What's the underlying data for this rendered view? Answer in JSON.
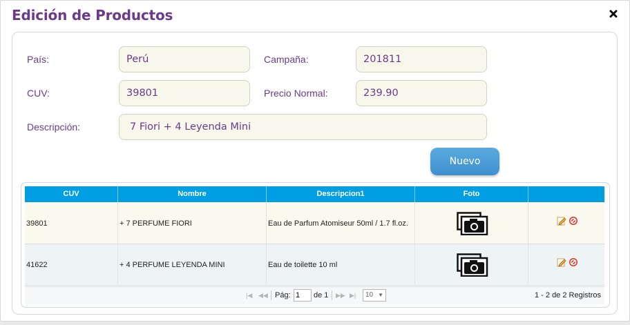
{
  "dialog": {
    "title": "Edición de Productos",
    "close_icon": "close-icon"
  },
  "form": {
    "pais_label": "País:",
    "pais_value": "Perú",
    "campana_label": "Campaña:",
    "campana_value": "201811",
    "cuv_label": "CUV:",
    "cuv_value": "39801",
    "precio_label": "Precio Normal:",
    "precio_value": "239.90",
    "descripcion_label": "Descripción:",
    "descripcion_value": "7 Fiori + 4 Leyenda Mini",
    "nuevo_button": "Nuevo"
  },
  "grid": {
    "columns": [
      "CUV",
      "Nombre",
      "Descripcion1",
      "Foto",
      ""
    ],
    "rows": [
      {
        "cuv": "39801",
        "nombre": "+ 7 PERFUME FIORI",
        "descripcion": "Eau de Parfum Atomiseur 50ml / 1.7 fl.oz.",
        "foto_icon": "camera-icon"
      },
      {
        "cuv": "41622",
        "nombre": "+ 4 PERFUME LEYENDA MINI",
        "descripcion": "Eau de toilette 10 ml",
        "foto_icon": "camera-icon"
      }
    ],
    "pager": {
      "page_label": "Pág:",
      "page_value": "1",
      "of_label": "de 1",
      "rows_per_page": "10",
      "records_text": "1 - 2 de 2 Registros"
    }
  },
  "colors": {
    "title": "#6b3a8c",
    "header_bg": "#009fe3",
    "row_odd": "#fbf8ee",
    "row_even": "#eef3f6",
    "button": "#4a9bd9"
  }
}
